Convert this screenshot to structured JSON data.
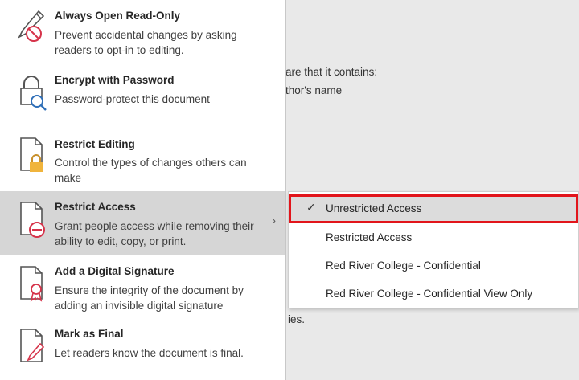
{
  "menu": {
    "items": [
      {
        "id": "read-only",
        "title": "Always Open Read-Only",
        "desc": "Prevent accidental changes by asking readers to opt-in to editing."
      },
      {
        "id": "encrypt",
        "title": "Encrypt with Password",
        "desc": "Password-protect this document"
      },
      {
        "id": "restrict-editing",
        "title": "Restrict Editing",
        "desc": "Control the types of changes others can make"
      },
      {
        "id": "restrict-access",
        "title": "Restrict Access",
        "desc": "Grant people access while removing their ability to edit, copy, or print.",
        "has_submenu": true
      },
      {
        "id": "digital-signature",
        "title": "Add a Digital Signature",
        "desc": "Ensure the integrity of the document by adding an invisible digital signature"
      },
      {
        "id": "mark-final",
        "title": "Mark as Final",
        "desc": "Let readers know the document is final."
      }
    ],
    "chevron": "›"
  },
  "background": {
    "line1": "are that it contains:",
    "line2": "thor's name",
    "line3": "ies."
  },
  "submenu": {
    "items": [
      {
        "label": "Unrestricted Access",
        "checked": true
      },
      {
        "label": "Restricted Access",
        "checked": false
      },
      {
        "label": "Red River College - Confidential",
        "checked": false
      },
      {
        "label": "Red River College - Confidential View Only",
        "checked": false
      }
    ],
    "check_glyph": "✓"
  },
  "colors": {
    "highlight_border": "#e2151b",
    "hover_bg": "#d6d6d6",
    "lock_color": "#f0b43c",
    "prohibit_color": "#d6334a"
  }
}
